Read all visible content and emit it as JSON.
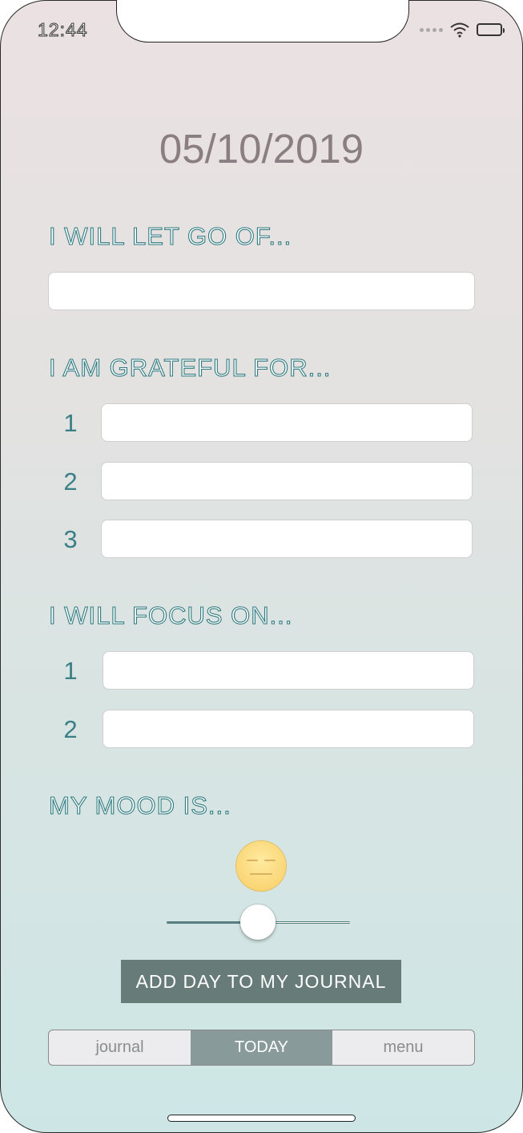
{
  "status_bar": {
    "time": "12:44",
    "icons": [
      "cellular-signal-icon",
      "wifi-icon",
      "battery-icon"
    ]
  },
  "header": {
    "date": "05/10/2019"
  },
  "let_go": {
    "label": "I WILL LET GO OF...",
    "value": "",
    "placeholder": ""
  },
  "grateful": {
    "label": "I AM GRATEFUL FOR...",
    "items": [
      {
        "number": "1",
        "value": ""
      },
      {
        "number": "2",
        "value": ""
      },
      {
        "number": "3",
        "value": ""
      }
    ]
  },
  "focus": {
    "label": "I WILL FOCUS ON...",
    "items": [
      {
        "number": "1",
        "value": ""
      },
      {
        "number": "2",
        "value": ""
      }
    ]
  },
  "mood": {
    "label": "MY MOOD IS...",
    "emoji": "neutral-face-icon",
    "slider_value": 0.5
  },
  "actions": {
    "add_day_label": "ADD DAY TO MY JOURNAL"
  },
  "tabs": [
    {
      "label": "journal",
      "active": false
    },
    {
      "label": "TODAY",
      "active": true
    },
    {
      "label": "menu",
      "active": false
    }
  ],
  "colors": {
    "accent": "#2f7a80",
    "button": "#677b79",
    "date": "#8b7e82",
    "active_tab": "#899a9b"
  }
}
